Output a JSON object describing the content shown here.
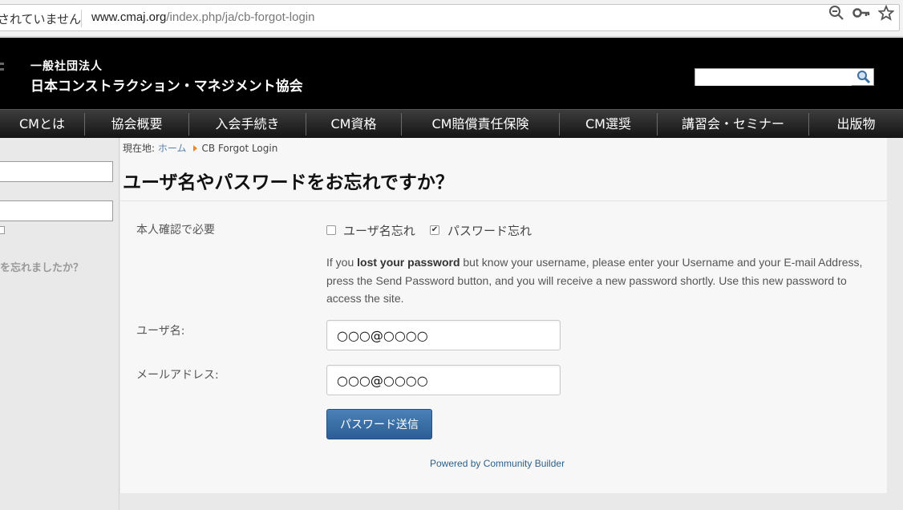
{
  "browser": {
    "security_text": "されていません",
    "url_host": "www.cmaj.org",
    "url_path": "/index.php/ja/cb-forgot-login",
    "icons": [
      "zoom-out-icon",
      "key-icon",
      "star-icon"
    ]
  },
  "header": {
    "org_line1": "一般社団法人",
    "org_line2": "日本コンストラクション・マネジメント協会",
    "search_value": ""
  },
  "nav": {
    "items": [
      {
        "label": "CMとは"
      },
      {
        "label": "協会概要"
      },
      {
        "label": "入会手続き"
      },
      {
        "label": "CM資格"
      },
      {
        "label": "CM賠償責任保険"
      },
      {
        "label": "CM選奨"
      },
      {
        "label": "講習会・セミナー"
      },
      {
        "label": "出版物"
      }
    ]
  },
  "sidebar": {
    "forgot_text": "を忘れましたか？"
  },
  "breadcrumb": {
    "prefix": "現在地:",
    "home": "ホーム",
    "current": "CB Forgot Login"
  },
  "page": {
    "title": "ユーザ名やパスワードをお忘れですか？",
    "verify_label": "本人確認で必要",
    "option_username": "ユーザ名忘れ",
    "option_password": "パスワード忘れ",
    "option_username_checked": false,
    "option_password_checked": true,
    "help_prefix": "If you ",
    "help_bold": "lost your password",
    "help_suffix": " but know your username, please enter your Username and your E-mail Address, press the Send Password button, and you will receive a new password shortly. Use this new password to access the site.",
    "username_label": "ユーザ名:",
    "username_value": "○○○@○○○○",
    "email_label": "メールアドレス:",
    "email_value": "○○○@○○○○",
    "submit_label": "パスワード送信",
    "powered_by": "Powered by Community Builder"
  },
  "colors": {
    "header_bg": "#000000",
    "button_blue": "#2b5e93",
    "link_blue": "#2d5f8a",
    "breadcrumb_arrow": "#e08b2a"
  }
}
